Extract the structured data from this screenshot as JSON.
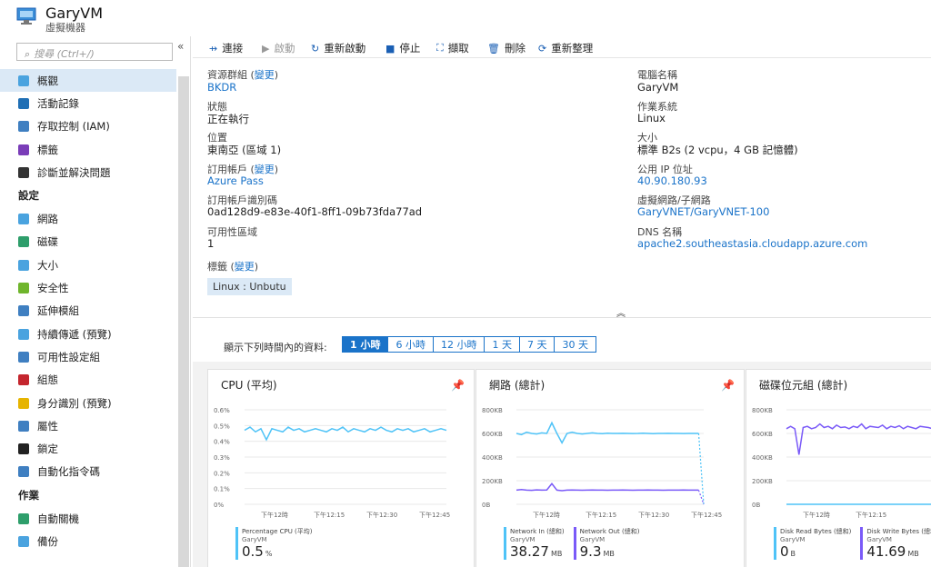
{
  "header": {
    "title": "GaryVM",
    "subtitle": "虛擬機器"
  },
  "search": {
    "placeholder": "搜尋 (Ctrl+/)"
  },
  "sidebar": {
    "items": [
      {
        "label": "概觀",
        "color": "#4aa3df"
      },
      {
        "label": "活動記錄",
        "color": "#1f6fb5"
      },
      {
        "label": "存取控制 (IAM)",
        "color": "#3f7fc1"
      },
      {
        "label": "標籤",
        "color": "#7a3db8"
      },
      {
        "label": "診斷並解決問題",
        "color": "#333333"
      }
    ],
    "section_settings": "設定",
    "settings_items": [
      {
        "label": "網路",
        "color": "#4aa3df"
      },
      {
        "label": "磁碟",
        "color": "#2e9e6b"
      },
      {
        "label": "大小",
        "color": "#4aa3df"
      },
      {
        "label": "安全性",
        "color": "#6fb52c"
      },
      {
        "label": "延伸模組",
        "color": "#3f7fc1"
      },
      {
        "label": "持續傳遞 (預覽)",
        "color": "#4aa3df"
      },
      {
        "label": "可用性設定組",
        "color": "#3f7fc1"
      },
      {
        "label": "組態",
        "color": "#c4262e"
      },
      {
        "label": "身分識別 (預覽)",
        "color": "#e6b400"
      },
      {
        "label": "屬性",
        "color": "#3f7fc1"
      },
      {
        "label": "鎖定",
        "color": "#222222"
      },
      {
        "label": "自動化指令碼",
        "color": "#3f7fc1"
      }
    ],
    "section_ops": "作業",
    "ops_items": [
      {
        "label": "自動關機",
        "color": "#2e9e6b"
      },
      {
        "label": "備份",
        "color": "#4aa3df"
      }
    ]
  },
  "toolbar": {
    "connect": "連接",
    "start": "啟動",
    "restart": "重新啟動",
    "stop": "停止",
    "capture": "擷取",
    "delete": "刪除",
    "refresh": "重新整理"
  },
  "essentials": {
    "rg_label": "資源群組",
    "change": "變更",
    "rg_value": "BKDR",
    "status_label": "狀態",
    "status_value": "正在執行",
    "location_label": "位置",
    "location_value": "東南亞 (區域 1)",
    "sub_label": "訂用帳戶",
    "sub_value": "Azure Pass",
    "subid_label": "訂用帳戶識別碼",
    "subid_value": "0ad128d9-e83e-40f1-8ff1-09b73fda77ad",
    "zone_label": "可用性區域",
    "zone_value": "1",
    "tags_label": "標籤",
    "tag_value": "Linux : Unbutu",
    "computer_label": "電腦名稱",
    "computer_value": "GaryVM",
    "os_label": "作業系統",
    "os_value": "Linux",
    "size_label": "大小",
    "size_value": "標準 B2s (2 vcpu，4 GB 記憶體)",
    "ip_label": "公用 IP 位址",
    "ip_value": "40.90.180.93",
    "vnet_label": "虛擬網路/子網路",
    "vnet_value": "GaryVNET/GaryVNET-100",
    "dns_label": "DNS 名稱",
    "dns_value": "apache2.southeastasia.cloudapp.azure.com"
  },
  "range": {
    "label": "顯示下列時間內的資料:",
    "options": [
      "1 小時",
      "6 小時",
      "12 小時",
      "1 天",
      "7 天",
      "30 天"
    ],
    "selected": "1 小時"
  },
  "chart_data": [
    {
      "type": "line",
      "title": "CPU (平均)",
      "yticks": [
        "0.6%",
        "0.5%",
        "0.4%",
        "0.3%",
        "0.2%",
        "0.1%",
        "0%"
      ],
      "ylim": [
        0,
        0.6
      ],
      "xticks": [
        "下午12時",
        "下午12:15",
        "下午12:30",
        "下午12:45"
      ],
      "series": [
        {
          "name": "Percentage CPU (平均)",
          "color": "#4fc3f7",
          "values": [
            0.47,
            0.49,
            0.46,
            0.48,
            0.41,
            0.48,
            0.47,
            0.46,
            0.49,
            0.47,
            0.48,
            0.46,
            0.47,
            0.48,
            0.47,
            0.46,
            0.48,
            0.47,
            0.49,
            0.46,
            0.48,
            0.47,
            0.46,
            0.48,
            0.47,
            0.49,
            0.47,
            0.46,
            0.48,
            0.47,
            0.48,
            0.46,
            0.47,
            0.48,
            0.46,
            0.47,
            0.48,
            0.47
          ]
        }
      ],
      "legend": [
        {
          "name": "Percentage CPU (平均)",
          "sub": "GaryVM",
          "value": "0.5",
          "unit": "%",
          "color": "#4fc3f7"
        }
      ]
    },
    {
      "type": "line",
      "title": "網路 (總計)",
      "yticks": [
        "800KB",
        "600KB",
        "400KB",
        "200KB",
        "0B"
      ],
      "ylim": [
        0,
        800
      ],
      "xticks": [
        "下午12時",
        "下午12:15",
        "下午12:30",
        "下午12:45"
      ],
      "series": [
        {
          "name": "Network In (總和)",
          "color": "#4fc3f7",
          "values": [
            600,
            590,
            610,
            600,
            595,
            605,
            600,
            690,
            600,
            520,
            600,
            610,
            600,
            595,
            600,
            605,
            600,
            598,
            602,
            600,
            600,
            601,
            600,
            599,
            600,
            602,
            600,
            598,
            600,
            600,
            601,
            600,
            600,
            599,
            600,
            600,
            600,
            0
          ]
        },
        {
          "name": "Network Out (總和)",
          "color": "#7a5af8",
          "values": [
            120,
            125,
            120,
            118,
            122,
            120,
            121,
            175,
            120,
            115,
            120,
            121,
            120,
            119,
            120,
            121,
            120,
            120,
            119,
            120,
            120,
            121,
            120,
            119,
            120,
            120,
            121,
            120,
            120,
            119,
            120,
            120,
            120,
            121,
            120,
            120,
            120,
            0
          ]
        }
      ],
      "legend": [
        {
          "name": "Network In (總和)",
          "sub": "GaryVM",
          "value": "38.27",
          "unit": "MB",
          "color": "#4fc3f7"
        },
        {
          "name": "Network Out (總和)",
          "sub": "GaryVM",
          "value": "9.3",
          "unit": "MB",
          "color": "#7a5af8"
        }
      ]
    },
    {
      "type": "line",
      "title": "磁碟位元組 (總計)",
      "yticks": [
        "800KB",
        "600KB",
        "400KB",
        "200KB",
        "0B"
      ],
      "ylim": [
        0,
        800
      ],
      "xticks": [
        "下午12時",
        "下午12:15"
      ],
      "series": [
        {
          "name": "Disk Read Bytes (總和)",
          "color": "#4fc3f7",
          "values": [
            0,
            0,
            0,
            0,
            0,
            0,
            0,
            0,
            0,
            0,
            0,
            0,
            0,
            0,
            0,
            0,
            0,
            0,
            0,
            0,
            0,
            0,
            0,
            0,
            0,
            0,
            0,
            0,
            0,
            0,
            0,
            0,
            0,
            0,
            0,
            0,
            0,
            0
          ]
        },
        {
          "name": "Disk Write Bytes (總和)",
          "color": "#7a5af8",
          "values": [
            640,
            660,
            640,
            420,
            650,
            660,
            640,
            650,
            680,
            650,
            660,
            640,
            670,
            650,
            655,
            640,
            660,
            650,
            680,
            640,
            660,
            655,
            650,
            670,
            640,
            660,
            650,
            665,
            640,
            660,
            650,
            640,
            660,
            655,
            650,
            640,
            650,
            660
          ]
        }
      ],
      "legend": [
        {
          "name": "Disk Read Bytes (總和)",
          "sub": "GaryVM",
          "value": "0",
          "unit": "B",
          "color": "#4fc3f7"
        },
        {
          "name": "Disk Write Bytes (總和)",
          "sub": "GaryVM",
          "value": "41.69",
          "unit": "MB",
          "color": "#7a5af8"
        }
      ]
    }
  ]
}
